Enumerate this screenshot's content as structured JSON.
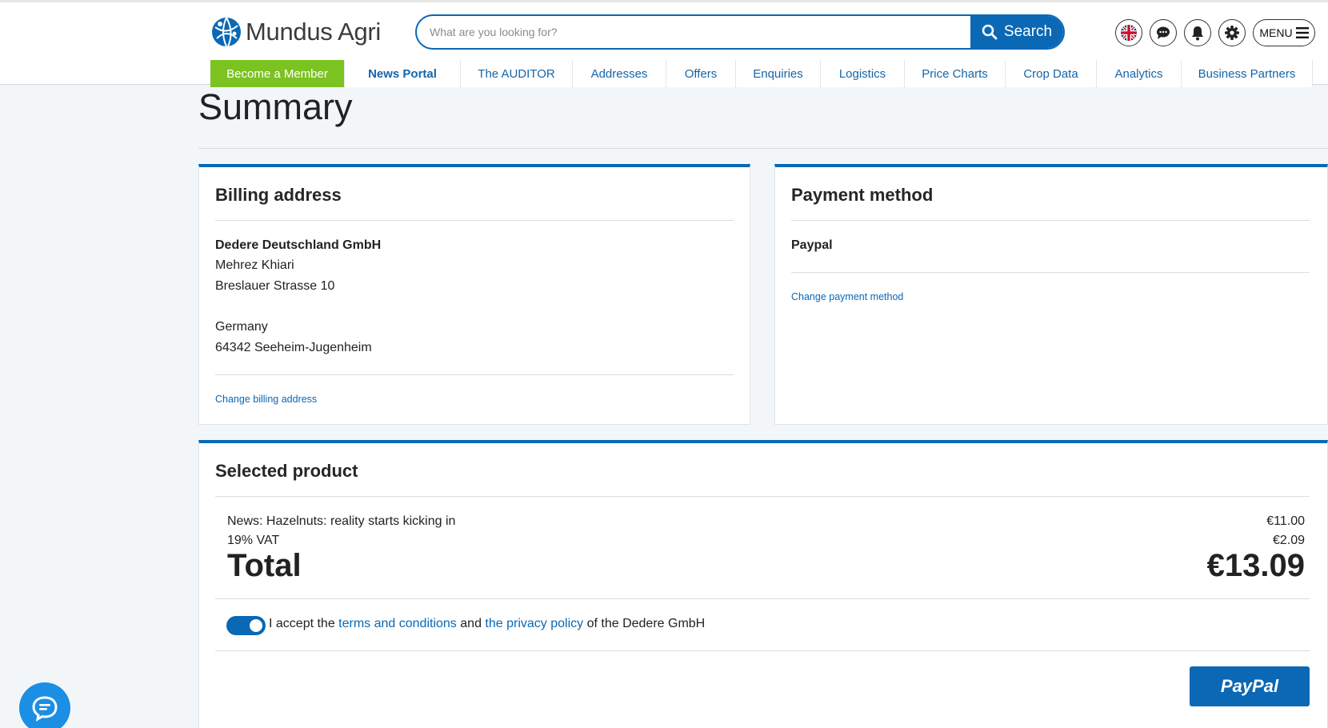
{
  "header": {
    "logo_text": "Mundus Agri",
    "search_placeholder": "What are you looking for?",
    "search_label": "Search",
    "menu_label": "MENU"
  },
  "nav": {
    "items": [
      {
        "label": "Become a Member"
      },
      {
        "label": "News Portal"
      },
      {
        "label": "The AUDITOR"
      },
      {
        "label": "Addresses"
      },
      {
        "label": "Offers"
      },
      {
        "label": "Enquiries"
      },
      {
        "label": "Logistics"
      },
      {
        "label": "Price Charts"
      },
      {
        "label": "Crop Data"
      },
      {
        "label": "Analytics"
      },
      {
        "label": "Business Partners"
      }
    ]
  },
  "page": {
    "title": "Summary"
  },
  "billing": {
    "heading": "Billing address",
    "company": "Dedere Deutschland GmbH",
    "name": "Mehrez Khiari",
    "street": "Breslauer Strasse 10",
    "country": "Germany",
    "city": "64342 Seeheim-Jugenheim",
    "change_link": "Change billing address"
  },
  "payment": {
    "heading": "Payment method",
    "method": "Paypal",
    "change_link": "Change payment method"
  },
  "product": {
    "heading": "Selected product",
    "item_label": "News: Hazelnuts: reality starts kicking in",
    "item_price": "€11.00",
    "vat_label": "19% VAT",
    "vat_price": "€2.09",
    "total_label": "Total",
    "total_price": "€13.09"
  },
  "terms": {
    "prefix": "I accept the",
    "terms_link": "terms and conditions",
    "and": "and",
    "privacy_link": "the privacy policy",
    "suffix": "of the Dedere GmbH",
    "accepted": true
  },
  "checkout": {
    "paypal_label": "PayPal"
  },
  "colors": {
    "primary": "#0a68b5",
    "member_green": "#7cc321",
    "chat": "#1a8fe3"
  }
}
